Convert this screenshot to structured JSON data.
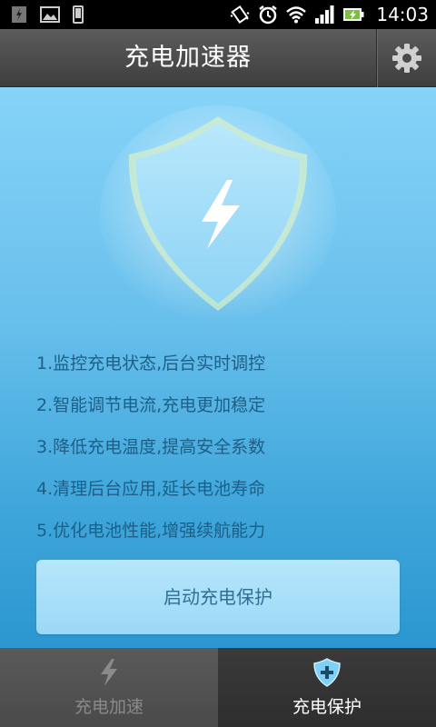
{
  "status_bar": {
    "time": "14:03",
    "left_icons": [
      "usb-debug-icon",
      "image-icon",
      "phone-icon"
    ],
    "right_icons": [
      "vibrate-icon",
      "alarm-icon",
      "wifi-icon",
      "signal-icon",
      "battery-charging-icon"
    ]
  },
  "header": {
    "title": "充电加速器",
    "settings_icon": "gear-icon"
  },
  "hero": {
    "icon": "shield-lightning-icon"
  },
  "features": [
    "1.监控充电状态,后台实时调控",
    "2.智能调节电流,充电更加稳定",
    "3.降低充电温度,提高安全系数",
    "4.清理后台应用,延长电池寿命",
    "5.优化电池性能,增强续航能力"
  ],
  "main": {
    "start_button": "启动充电保护"
  },
  "tabs": [
    {
      "label": "充电加速",
      "icon": "lightning-icon",
      "active": false
    },
    {
      "label": "充电保护",
      "icon": "shield-plus-icon",
      "active": true
    }
  ],
  "colors": {
    "accent": "#2b96cf",
    "header_bg": "#4a4a4a",
    "feature_text": "#1d5f86"
  }
}
